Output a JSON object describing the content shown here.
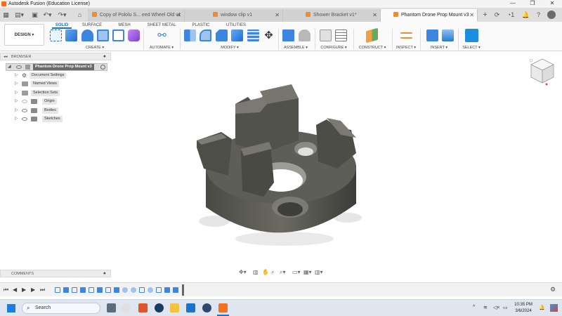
{
  "window": {
    "title": "Autodesk Fusion (Education License)",
    "minimize": "—",
    "maximize": "❐",
    "close": "✕"
  },
  "tabs": [
    {
      "label": "Copy of Pololu S... eed Wheel Old v1",
      "active": false
    },
    {
      "label": "window clip v1",
      "active": false
    },
    {
      "label": "Shower Bracket v1*",
      "active": false
    },
    {
      "label": "Phantom Drone Prop Mount v3",
      "active": true
    }
  ],
  "tabbar_right": {
    "job_count": "1"
  },
  "toolbar": {
    "design_label": "DESIGN ▾",
    "workspace_tabs": [
      {
        "label": "SOLID",
        "active": true
      },
      {
        "label": "SURFACE",
        "active": false
      },
      {
        "label": "MESH",
        "active": false
      },
      {
        "label": "SHEET METAL",
        "active": false
      },
      {
        "label": "PLASTIC",
        "active": false
      },
      {
        "label": "UTILITIES",
        "active": false
      }
    ],
    "groups": {
      "create": "CREATE ▾",
      "automate": "AUTOMATE ▾",
      "modify": "MODIFY ▾",
      "assemble": "ASSEMBLE ▾",
      "configure": "CONFIGURE ▾",
      "construct": "CONSTRUCT ▾",
      "inspect": "INSPECT ▾",
      "insert": "INSERT ▾",
      "select": "SELECT ▾"
    }
  },
  "browser": {
    "header": "BROWSER",
    "root": "Phantom Drone Prop Mount v3",
    "items": [
      {
        "label": "Document Settings",
        "icon": "gear-icon"
      },
      {
        "label": "Named Views",
        "icon": "folder-icon"
      },
      {
        "label": "Selection Sets",
        "icon": "folder-icon"
      },
      {
        "label": "Origin",
        "icon": "folder-icon"
      },
      {
        "label": "Bodies",
        "icon": "folder-icon"
      },
      {
        "label": "Sketches",
        "icon": "folder-icon"
      }
    ]
  },
  "comments": {
    "header": "COMMENTS"
  },
  "taskbar": {
    "search_label": "Search",
    "time": "10:35 PM",
    "date": "3/6/2024"
  },
  "colors": {
    "accent": "#1b6fd3",
    "fusion_orange": "#f37021",
    "model_gray": "#595953"
  }
}
